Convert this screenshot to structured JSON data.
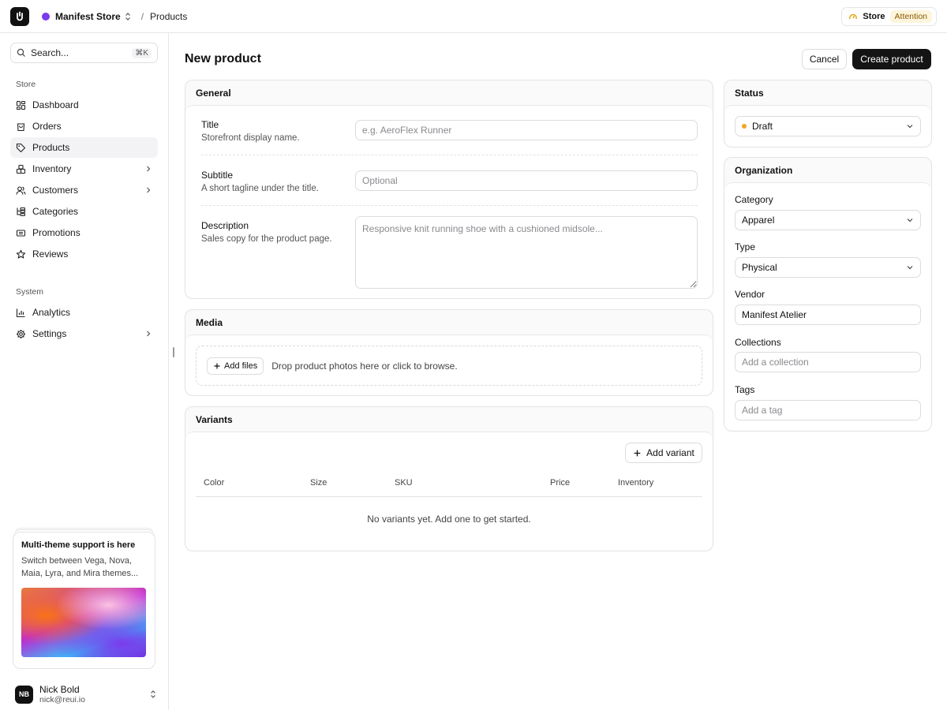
{
  "topbar": {
    "store_name": "Manifest Store",
    "breadcrumb_sep": "/",
    "breadcrumb_current": "Products",
    "store_status_label": "Store",
    "store_status_badge": "Attention"
  },
  "sidebar": {
    "search_placeholder": "Search...",
    "search_shortcut": "⌘K",
    "group_store": "Store",
    "store_items": [
      {
        "label": "Dashboard",
        "icon": "dashboard-icon"
      },
      {
        "label": "Orders",
        "icon": "orders-icon"
      },
      {
        "label": "Products",
        "icon": "tag-icon",
        "active": true
      },
      {
        "label": "Inventory",
        "icon": "inventory-icon",
        "chevron": true
      },
      {
        "label": "Customers",
        "icon": "users-icon",
        "chevron": true
      },
      {
        "label": "Categories",
        "icon": "categories-icon"
      },
      {
        "label": "Promotions",
        "icon": "ticket-icon"
      },
      {
        "label": "Reviews",
        "icon": "star-icon"
      }
    ],
    "group_system": "System",
    "system_items": [
      {
        "label": "Analytics",
        "icon": "chart-icon"
      },
      {
        "label": "Settings",
        "icon": "gear-icon",
        "chevron": true
      }
    ],
    "promo": {
      "title": "Multi-theme support is here",
      "text_line1": "Switch between Vega, Nova,",
      "text_line2": "Maia, Lyra, and Mira themes..."
    },
    "user": {
      "initials": "NB",
      "name": "Nick Bold",
      "email": "nick@reui.io"
    }
  },
  "main": {
    "title": "New product",
    "cancel_label": "Cancel",
    "create_label": "Create product",
    "general": {
      "heading": "General",
      "title_label": "Title",
      "title_help": "Storefront display name.",
      "title_placeholder": "e.g. AeroFlex Runner",
      "subtitle_label": "Subtitle",
      "subtitle_help": "A short tagline under the title.",
      "subtitle_placeholder": "Optional",
      "description_label": "Description",
      "description_help": "Sales copy for the product page.",
      "description_placeholder": "Responsive knit running shoe with a cushioned midsole..."
    },
    "media": {
      "heading": "Media",
      "add_files_label": "Add files",
      "drop_text": "Drop product photos here or click to browse."
    },
    "variants": {
      "heading": "Variants",
      "add_variant_label": "Add variant",
      "columns": [
        "Color",
        "Size",
        "SKU",
        "Price",
        "Inventory"
      ],
      "empty_text": "No variants yet. Add one to get started."
    }
  },
  "right": {
    "status": {
      "heading": "Status",
      "value": "Draft",
      "dot_color": "#f5a524"
    },
    "organization": {
      "heading": "Organization",
      "category_label": "Category",
      "category_value": "Apparel",
      "type_label": "Type",
      "type_value": "Physical",
      "vendor_label": "Vendor",
      "vendor_value": "Manifest Atelier",
      "collections_label": "Collections",
      "collections_placeholder": "Add a collection",
      "tags_label": "Tags",
      "tags_placeholder": "Add a tag"
    }
  }
}
